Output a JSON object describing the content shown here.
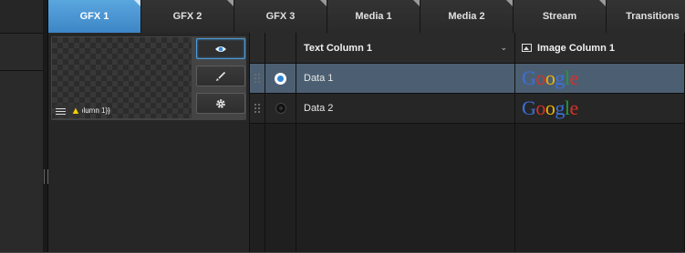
{
  "tabs": [
    {
      "label": "GFX 1",
      "active": true
    },
    {
      "label": "GFX 2",
      "active": false
    },
    {
      "label": "GFX 3",
      "active": false
    },
    {
      "label": "Media 1",
      "active": false
    },
    {
      "label": "Media 2",
      "active": false
    },
    {
      "label": "Stream",
      "active": false
    },
    {
      "label": "Transitions",
      "active": false
    }
  ],
  "preview": {
    "overlay_text": "olumn 1}}",
    "buttons": [
      {
        "icon": "eye-icon",
        "active": true
      },
      {
        "icon": "brush-icon",
        "active": false
      },
      {
        "icon": "gear-icon",
        "active": false
      }
    ]
  },
  "table": {
    "columns": [
      {
        "label": "Text Column 1"
      },
      {
        "label": "Image Column 1"
      }
    ],
    "rows": [
      {
        "text": "Data 1",
        "image_text": "Google",
        "selected": true
      },
      {
        "text": "Data 2",
        "image_text": "Google",
        "selected": false
      }
    ]
  },
  "colors": {
    "accent": "#3d86c6",
    "selected_row": "#4c5f72"
  }
}
